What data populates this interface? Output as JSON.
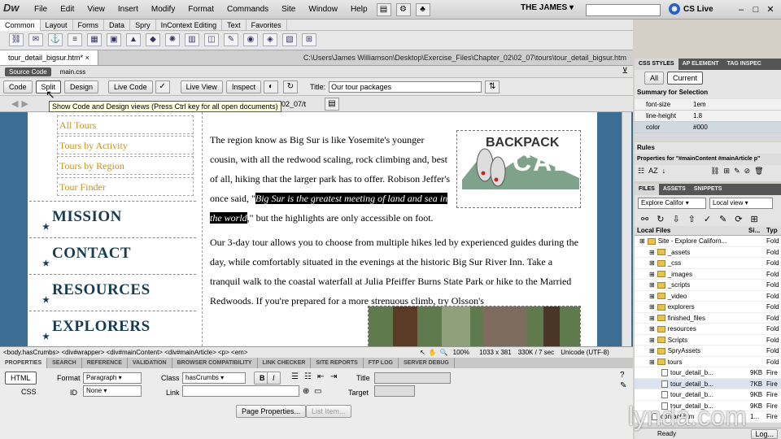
{
  "menubar": {
    "logo": "Dw",
    "items": [
      "File",
      "Edit",
      "View",
      "Insert",
      "Modify",
      "Format",
      "Commands",
      "Site",
      "Window",
      "Help"
    ],
    "workspace": "THE JAMES",
    "search_placeholder": "",
    "cslive": "CS Live"
  },
  "insert": {
    "tabs": [
      "Common",
      "Layout",
      "Forms",
      "Data",
      "Spry",
      "InContext Editing",
      "Text",
      "Favorites"
    ]
  },
  "doc": {
    "tab": "tour_detail_bigsur.htm*",
    "tab_close": "×",
    "css_tab": "main.css",
    "path": "C:\\Users\\James Williamson\\Desktop\\Exercise_Files\\Chapter_02\\02_07\\tours\\tour_detail_bigsur.htm",
    "related": [
      "Source Code",
      "main.css"
    ]
  },
  "doctools": {
    "code": "Code",
    "split": "Split",
    "design": "Design",
    "live_code": "Live Code",
    "live_view": "Live View",
    "inspect": "Inspect",
    "title_label": "Title:",
    "title_value": "Our tour packages"
  },
  "tooltip": "Show Code and Design views (Press Ctrl key for all open documents)",
  "address_partial": "pter_02/02_07/t",
  "page": {
    "nav": [
      "All Tours",
      "Tours by Activity",
      "Tours by Region",
      "Tour Finder"
    ],
    "sections": [
      "MISSION",
      "CONTACT",
      "RESOURCES",
      "EXPLORERS"
    ],
    "p1_a": "The region know as Big Sur is like Yosemite's younger cousin, with all the redwood scaling, rock climbing and, best of all, hiking that the larger park has to offer. Robison Jeffer's once said, \"",
    "p1_quote": "Big Sur is the greatest meeting of land and sea in the world",
    "p1_b": ",\" but the highlights are only accessible on foot.",
    "p2": "Our 3-day tour allows you to choose from multiple hikes led by experienced guides during the day, while comfortably situated in the evenings at the historic Big Sur River Inn. Take a tranquil walk to the coastal waterfall at Julia Pfeiffer Burns State Park or hike to the Married Redwoods. If you're prepared for a more strenuous climb, try Olsson's",
    "logo_top": "BACKPACK",
    "logo_bottom": "CAL"
  },
  "status": {
    "tags": "<body.hasCrumbs> <div#wrapper> <div#mainContent> <div#mainArticle> <p> <em>",
    "zoom": "100%",
    "dims": "1033 x 381",
    "size": "330K / 7 sec",
    "encoding": "Unicode (UTF-8)"
  },
  "panels": {
    "tabs": [
      "PROPERTIES",
      "SEARCH",
      "REFERENCE",
      "VALIDATION",
      "BROWSER COMPATIBILITY",
      "LINK CHECKER",
      "SITE REPORTS",
      "FTP LOG",
      "SERVER DEBUG"
    ]
  },
  "props": {
    "html": "HTML",
    "css": "CSS",
    "format_label": "Format",
    "format_value": "Paragraph",
    "class_label": "Class",
    "class_value": "hasCrumbs",
    "id_label": "ID",
    "id_value": "None",
    "link_label": "Link",
    "title_label": "Title",
    "target_label": "Target",
    "bold": "B",
    "italic": "I",
    "page_props": "Page Properties...",
    "list_item": "List Item..."
  },
  "css_panel": {
    "tabs": [
      "CSS STYLES",
      "AP ELEMENT",
      "TAG INSPEC"
    ],
    "all": "All",
    "current": "Current",
    "summary": "Summary for Selection",
    "rows": [
      {
        "k": "font-size",
        "v": "1em"
      },
      {
        "k": "line-height",
        "v": "1.8"
      },
      {
        "k": "color",
        "v": "#000"
      }
    ],
    "rules": "Rules",
    "properties": "Properties for \"#mainContent #mainArticle p\""
  },
  "files_panel": {
    "tabs": [
      "FILES",
      "ASSETS",
      "SNIPPETS"
    ],
    "site": "Explore Califor",
    "view": "Local view",
    "col_name": "Local Files",
    "col_size": "Si...",
    "col_type": "Typ",
    "rows": [
      {
        "name": "Site - Explore Californ...",
        "size": "",
        "type": "Fold",
        "depth": 0,
        "kind": "folder"
      },
      {
        "name": "_assets",
        "size": "",
        "type": "Fold",
        "depth": 1,
        "kind": "folder"
      },
      {
        "name": "_css",
        "size": "",
        "type": "Fold",
        "depth": 1,
        "kind": "folder"
      },
      {
        "name": "_images",
        "size": "",
        "type": "Fold",
        "depth": 1,
        "kind": "folder"
      },
      {
        "name": "_scripts",
        "size": "",
        "type": "Fold",
        "depth": 1,
        "kind": "folder"
      },
      {
        "name": "_video",
        "size": "",
        "type": "Fold",
        "depth": 1,
        "kind": "folder"
      },
      {
        "name": "explorers",
        "size": "",
        "type": "Fold",
        "depth": 1,
        "kind": "folder"
      },
      {
        "name": "finished_files",
        "size": "",
        "type": "Fold",
        "depth": 1,
        "kind": "folder"
      },
      {
        "name": "resources",
        "size": "",
        "type": "Fold",
        "depth": 1,
        "kind": "folder"
      },
      {
        "name": "Scripts",
        "size": "",
        "type": "Fold",
        "depth": 1,
        "kind": "folder"
      },
      {
        "name": "SpryAssets",
        "size": "",
        "type": "Fold",
        "depth": 1,
        "kind": "folder"
      },
      {
        "name": "tours",
        "size": "",
        "type": "Fold",
        "depth": 1,
        "kind": "folder"
      },
      {
        "name": "tour_detail_b...",
        "size": "9KB",
        "type": "Fire",
        "depth": 2,
        "kind": "file"
      },
      {
        "name": "tour_detail_b...",
        "size": "7KB",
        "type": "Fire",
        "depth": 2,
        "kind": "file"
      },
      {
        "name": "tour_detail_b...",
        "size": "9KB",
        "type": "Fire",
        "depth": 2,
        "kind": "file"
      },
      {
        "name": "tour_detail_b...",
        "size": "9KB",
        "type": "Fire",
        "depth": 2,
        "kind": "file"
      },
      {
        "name": "contact.htm",
        "size": "1...",
        "type": "Fire",
        "depth": 1,
        "kind": "file"
      }
    ],
    "status": "Ready",
    "log": "Log..."
  },
  "watermark": "lynda.com"
}
